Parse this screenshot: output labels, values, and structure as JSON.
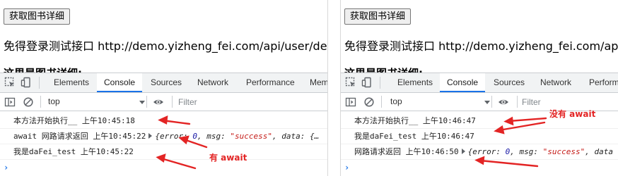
{
  "page": {
    "button_label": "获取图书详细",
    "intro_text": "免得登录测试接口 http://demo.yizheng_fei.com/api/user/detail",
    "cut_heading": "这里是图书详细:"
  },
  "devtools": {
    "tabs": [
      "Elements",
      "Console",
      "Sources",
      "Network",
      "Performance",
      "Memory"
    ],
    "active_tab": "Console",
    "context": "top",
    "filter_placeholder": "Filter",
    "prompt": "›"
  },
  "left_console": {
    "rows": [
      {
        "text": "本方法开始执行__ 上午10:45:18"
      },
      {
        "text": "await 网路请求返回 上午10:45:22",
        "object": true
      },
      {
        "text": "我是daFei_test 上午10:45:22"
      }
    ],
    "object_preview": {
      "key1": "error",
      "val1": "0",
      "key2": "msg",
      "val2": "\"success\"",
      "key3": "data",
      "tail": "{…"
    },
    "annotation": "有 await"
  },
  "right_console": {
    "rows": [
      {
        "text": "本方法开始执行__ 上午10:46:47"
      },
      {
        "text": "我是daFei_test 上午10:46:47"
      },
      {
        "text": "网路请求返回 上午10:46:50",
        "object": true
      }
    ],
    "object_preview": {
      "key1": "error",
      "val1": "0",
      "key2": "msg",
      "val2": "\"success\"",
      "key3": "data",
      "tail": ""
    },
    "annotation": "没有 await"
  },
  "colors": {
    "annotation_red": "#e32424",
    "tab_active_underline": "#1a73e8"
  }
}
